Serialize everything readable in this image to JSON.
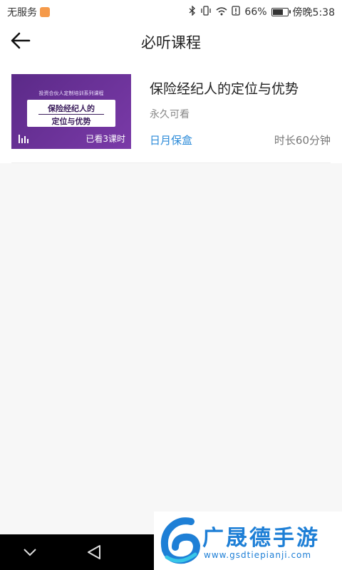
{
  "status_bar": {
    "carrier": "无服务",
    "battery_percent": "66%",
    "time": "傍晚5:38"
  },
  "header": {
    "title": "必听课程"
  },
  "courses": [
    {
      "title": "保险经纪人的定位与优势",
      "access": "永久可看",
      "provider": "日月保盒",
      "duration": "时长60分钟",
      "thumbnail": {
        "series_text": "投资合伙人定制培训系列课程",
        "line1": "保险经纪人的",
        "line2": "定位与优势",
        "watched": "已看3课时"
      }
    }
  ],
  "watermark": {
    "brand": "广晟德手游",
    "url": "www.gsdtiepianji.com"
  },
  "colors": {
    "accent": "#2a8ad8",
    "thumb_purple": "#6a2f97"
  }
}
